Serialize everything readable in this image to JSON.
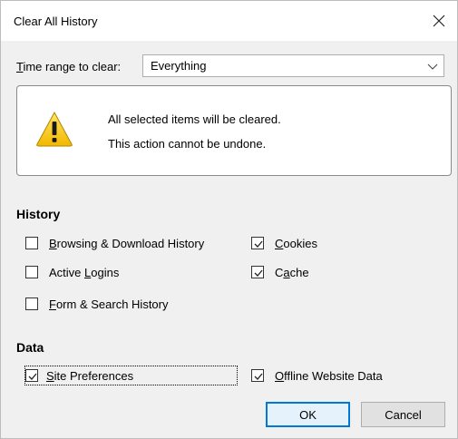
{
  "dialog": {
    "title": "Clear All History",
    "close_icon": "close-icon"
  },
  "time_range": {
    "label_accesskey": "T",
    "label_rest": "ime range to clear:",
    "selected": "Everything",
    "options": [
      "Everything"
    ]
  },
  "warning": {
    "icon": "warning-icon",
    "line1": "All selected items will be cleared.",
    "line2": "This action cannot be undone."
  },
  "history": {
    "heading": "History",
    "items": [
      {
        "pre": "",
        "key": "B",
        "post": "rowsing & Download History",
        "checked": false
      },
      {
        "pre": "",
        "key": "C",
        "post": "ookies",
        "checked": true
      },
      {
        "pre": "Active ",
        "key": "L",
        "post": "ogins",
        "checked": false
      },
      {
        "pre": "C",
        "key": "a",
        "post": "che",
        "checked": true
      },
      {
        "pre": "",
        "key": "F",
        "post": "orm & Search History",
        "checked": false
      }
    ]
  },
  "data": {
    "heading": "Data",
    "items": [
      {
        "pre": "",
        "key": "S",
        "post": "ite Preferences",
        "checked": true
      },
      {
        "pre": "",
        "key": "O",
        "post": "ffline Website Data",
        "checked": true
      }
    ]
  },
  "buttons": {
    "ok": "OK",
    "cancel": "Cancel"
  }
}
